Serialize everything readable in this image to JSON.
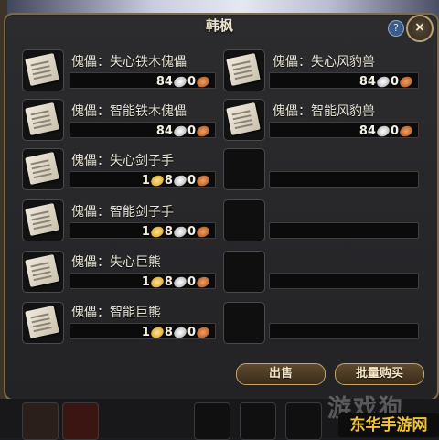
{
  "window": {
    "title": "韩枫",
    "help_icon_glyph": "?",
    "close_icon_glyph": "×"
  },
  "items": [
    {
      "name": "傀儡：失心铁木傀儡",
      "gold": "",
      "silver": "84",
      "copper": "0"
    },
    {
      "name": "傀儡：失心风豹兽",
      "gold": "",
      "silver": "84",
      "copper": "0"
    },
    {
      "name": "傀儡：智能铁木傀儡",
      "gold": "",
      "silver": "84",
      "copper": "0"
    },
    {
      "name": "傀儡：智能风豹兽",
      "gold": "",
      "silver": "84",
      "copper": "0"
    },
    {
      "name": "傀儡：失心剑子手",
      "gold": "1",
      "silver": "8",
      "copper": "0"
    },
    {
      "name": "傀儡：智能剑子手",
      "gold": "1",
      "silver": "8",
      "copper": "0"
    },
    {
      "name": "傀儡：失心巨熊",
      "gold": "1",
      "silver": "8",
      "copper": "0"
    },
    {
      "name": "傀儡：智能巨熊",
      "gold": "1",
      "silver": "8",
      "copper": "0"
    }
  ],
  "buttons": {
    "sell": "出售",
    "bulk_buy": "批量购买"
  },
  "watermark": {
    "main": "游戏狗",
    "sub": "东华手游网"
  },
  "colors": {
    "text": "#e7e3d6",
    "button_border": "#c8a46a",
    "panel_border": "#7a6a4e"
  }
}
